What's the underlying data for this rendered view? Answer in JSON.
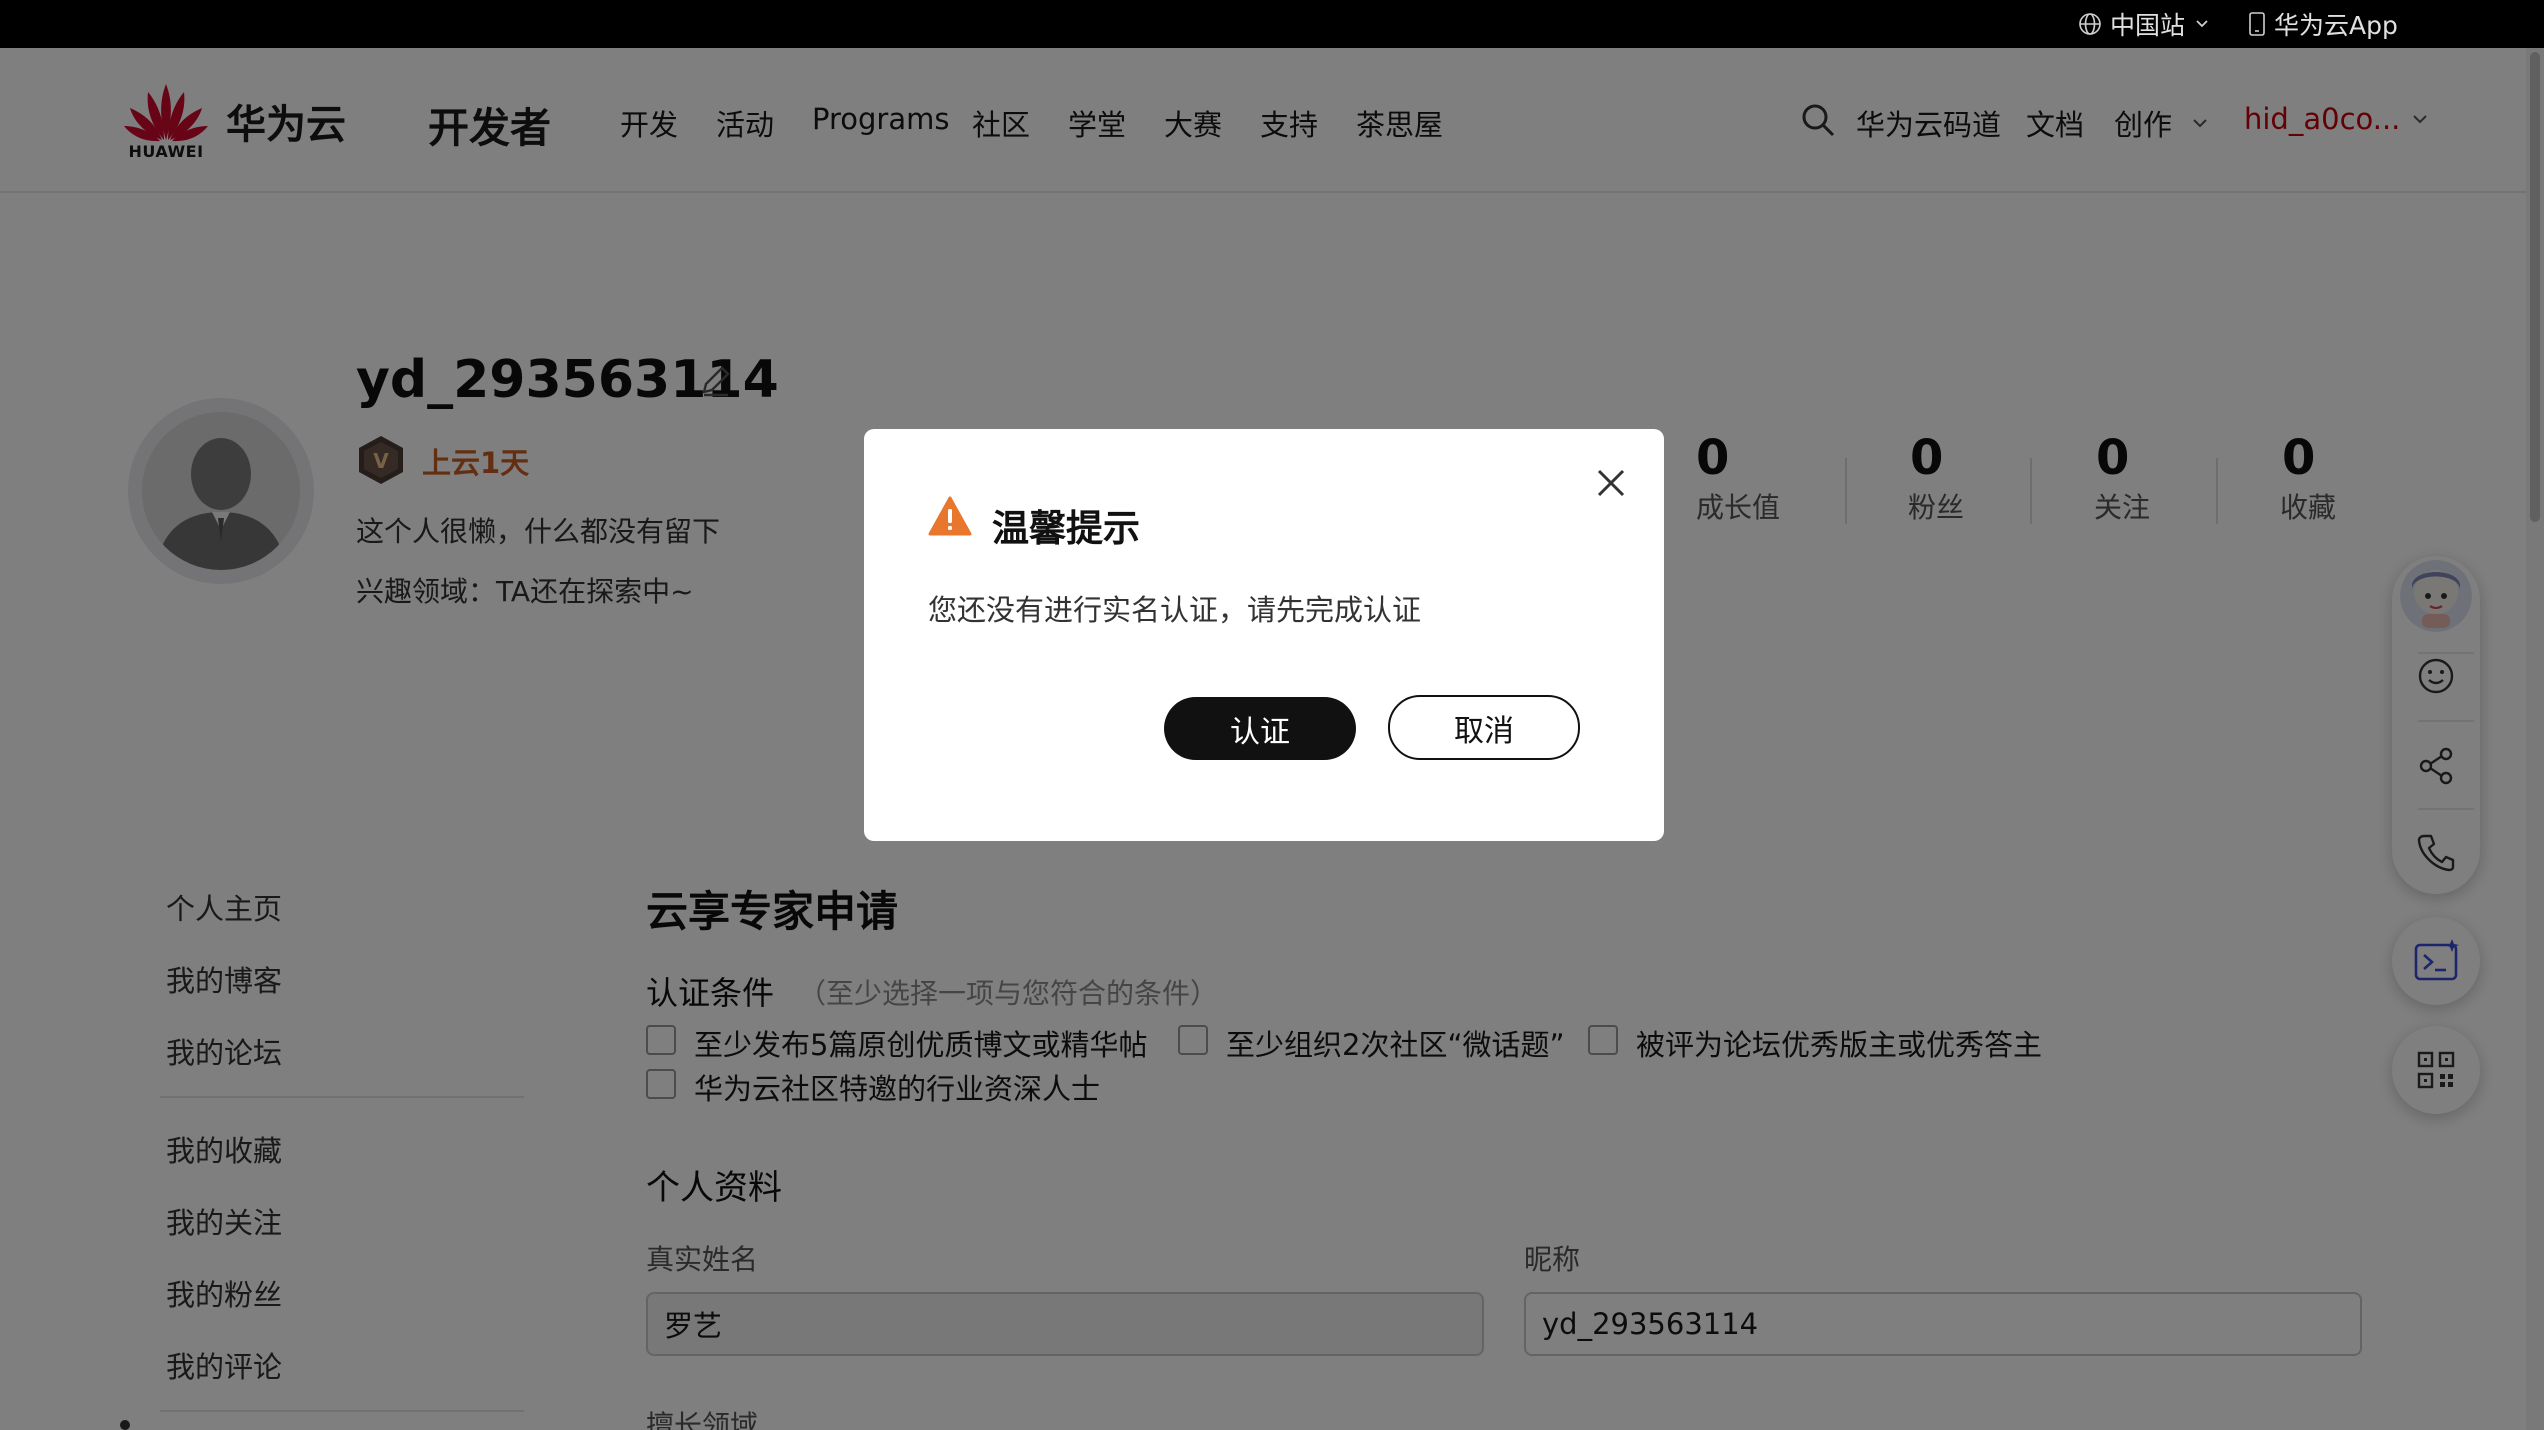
{
  "topbar": {
    "region": "中国站",
    "app": "华为云App"
  },
  "header": {
    "logo_text": "HUAWEI",
    "brand": "华为云",
    "site": "开发者",
    "nav": [
      "开发",
      "活动",
      "Programs",
      "社区",
      "学堂",
      "大赛",
      "支持",
      "茶思屋"
    ],
    "codearts": "华为云码道",
    "docs": "文档",
    "create": "创作",
    "user": "hid_a0co..."
  },
  "profile": {
    "username": "yd_293563114",
    "level": "上云1天",
    "bio": "这个人很懒，什么都没有留下",
    "interest": "兴趣领域：TA还在探索中~",
    "stats": [
      {
        "value": "0",
        "label": "成长值"
      },
      {
        "value": "0",
        "label": "粉丝"
      },
      {
        "value": "0",
        "label": "关注"
      },
      {
        "value": "0",
        "label": "收藏"
      }
    ]
  },
  "menu": [
    "个人主页",
    "我的博客",
    "我的论坛",
    "我的收藏",
    "我的关注",
    "我的粉丝",
    "我的评论"
  ],
  "form": {
    "title": "云享专家申请",
    "conditions_title": "认证条件",
    "conditions_hint": "（至少选择一项与您符合的条件）",
    "conditions": [
      "至少发布5篇原创优质博文或精华帖",
      "至少组织2次社区“微话题”",
      "被评为论坛优秀版主或优秀答主",
      "华为云社区特邀的行业资深人士"
    ],
    "profile_title": "个人资料",
    "real_name_label": "真实姓名",
    "real_name_value": "罗艺",
    "nickname_label": "昵称",
    "nickname_value": "yd_293563114",
    "expertise_label": "擅长领域"
  },
  "dialog": {
    "title": "温馨提示",
    "message": "您还没有进行实名认证，请先完成认证",
    "confirm": "认证",
    "cancel": "取消"
  },
  "colors": {
    "accent": "#c7000b",
    "warning": "#e8762c",
    "level": "#c95d25"
  }
}
